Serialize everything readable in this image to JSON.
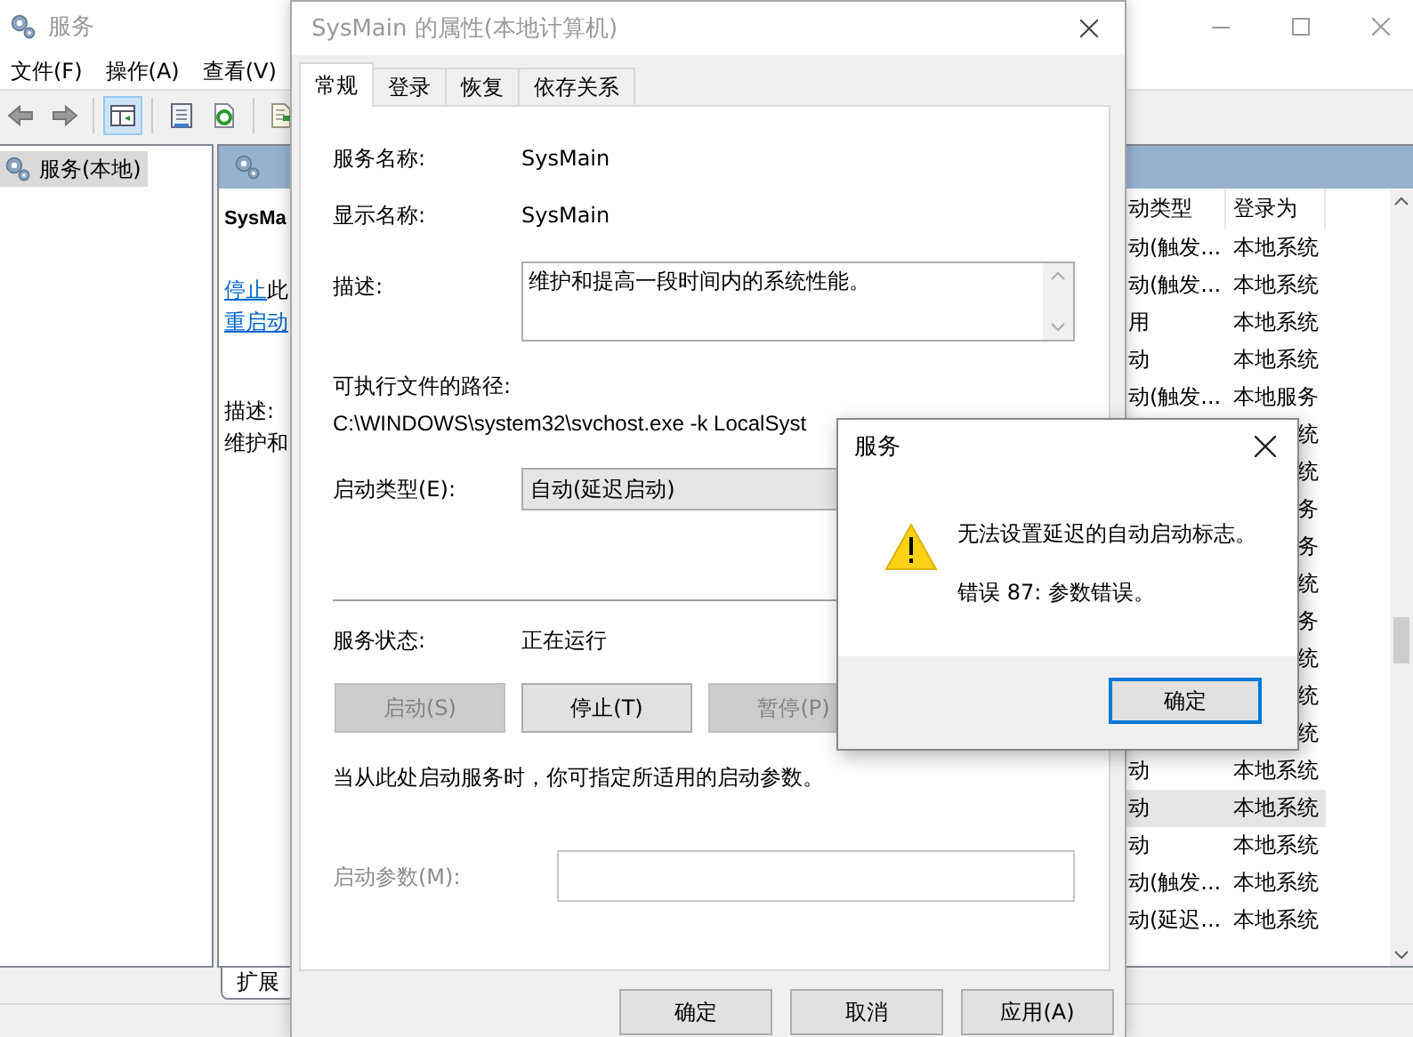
{
  "main_window": {
    "title": "服务",
    "menu": [
      "文件(F)",
      "操作(A)",
      "查看(V)"
    ],
    "toolbar": [
      {
        "kind": "back",
        "selected": false
      },
      {
        "kind": "forward",
        "selected": false
      },
      {
        "kind": "pane",
        "selected": true
      },
      {
        "kind": "properties",
        "selected": false
      },
      {
        "kind": "refresh",
        "selected": false
      },
      {
        "kind": "export",
        "selected": false
      }
    ],
    "tree": [
      {
        "label": "服务(本地)",
        "selected": true
      }
    ],
    "extended_pane": {
      "service_name": "SysMa",
      "actions": [
        {
          "link": "停止",
          "text": "此"
        },
        {
          "link": "重启动"
        }
      ],
      "description_label": "描述:",
      "description": "维护和"
    },
    "list": {
      "columns": [
        "动类型",
        "登录为"
      ],
      "rows": [
        {
          "startup_type": "动(触发...",
          "log_on_as": "本地系统",
          "selected": false
        },
        {
          "startup_type": "动(触发...",
          "log_on_as": "本地系统",
          "selected": false
        },
        {
          "startup_type": "用",
          "log_on_as": "本地系统",
          "selected": false
        },
        {
          "startup_type": "动",
          "log_on_as": "本地系统",
          "selected": false
        },
        {
          "startup_type": "动(触发...",
          "log_on_as": "本地服务",
          "selected": false
        },
        {
          "log_on_as": "统",
          "selected": false
        },
        {
          "log_on_as": "统",
          "selected": false
        },
        {
          "log_on_as": "务",
          "selected": false
        },
        {
          "log_on_as": "务",
          "selected": false
        },
        {
          "log_on_as": "统",
          "selected": false
        },
        {
          "log_on_as": "务",
          "selected": false
        },
        {
          "log_on_as": "统",
          "selected": false
        },
        {
          "log_on_as": "统",
          "selected": false
        },
        {
          "log_on_as": "统",
          "selected": false
        },
        {
          "startup_type": "动",
          "log_on_as": "本地系统",
          "selected": false
        },
        {
          "startup_type": "动",
          "log_on_as": "本地系统",
          "selected": true
        },
        {
          "startup_type": "动",
          "log_on_as": "本地系统",
          "selected": false
        },
        {
          "startup_type": "动(触发...",
          "log_on_as": "本地系统",
          "selected": false
        },
        {
          "startup_type": "动(延迟...",
          "log_on_as": "本地系统",
          "selected": false
        }
      ]
    },
    "bottom_tabs": [
      {
        "label": "扩展",
        "selected": true
      }
    ]
  },
  "properties_dialog": {
    "title": "SysMain 的属性(本地计算机)",
    "tabs": [
      {
        "label": "常规",
        "selected": true
      },
      {
        "label": "登录",
        "selected": false
      },
      {
        "label": "恢复",
        "selected": false
      },
      {
        "label": "依存关系",
        "selected": false
      }
    ],
    "service_name_label": "服务名称:",
    "service_name": "SysMain",
    "display_name_label": "显示名称:",
    "display_name": "SysMain",
    "description_label": "描述:",
    "description": "维护和提高一段时间内的系统性能。",
    "path_label": "可执行文件的路径:",
    "path": "C:\\WINDOWS\\system32\\svchost.exe -k LocalSyst",
    "startup_type_label": "启动类型(E):",
    "startup_type": "自动(延迟启动)",
    "status_label": "服务状态:",
    "status": "正在运行",
    "control_buttons": [
      {
        "label": "启动(S)",
        "disabled": true
      },
      {
        "label": "停止(T)",
        "disabled": false
      },
      {
        "label": "暂停(P)",
        "disabled": true
      }
    ],
    "note": "当从此处启动服务时，你可指定所适用的启动参数。",
    "parameters": {
      "label": "启动参数(M):",
      "disabled": true
    },
    "buttons": [
      "确定",
      "取消",
      "应用(A)"
    ]
  },
  "message_box": {
    "title": "服务",
    "message": "无法设置延迟的自动启动标志。",
    "detail": "错误 87: 参数错误。",
    "button": "确定"
  }
}
